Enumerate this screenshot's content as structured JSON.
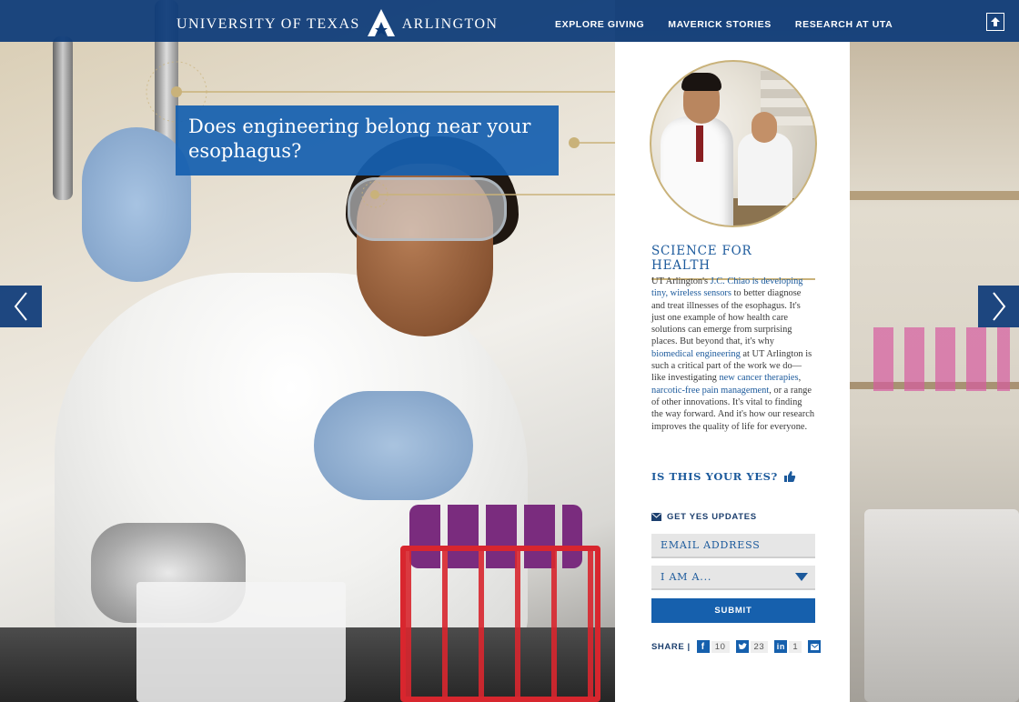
{
  "header": {
    "brand_left": "UNIVERSITY OF TEXAS",
    "brand_right": "ARLINGTON",
    "nav": [
      "EXPLORE GIVING",
      "MAVERICK STORIES",
      "RESEARCH AT UTA"
    ],
    "top_icon": "arrow-up-icon"
  },
  "headline": "Does engineering belong near your esophagus?",
  "panel": {
    "title": "SCIENCE FOR HEALTH",
    "body": {
      "t1": "UT Arlington's ",
      "l1": "J.C. Chiao is developing tiny, wireless sensors",
      "t2": " to better diagnose and treat illnesses of the esophagus. It's just one example of how health care solutions can emerge from surprising places. But beyond that, it's why ",
      "l2": "biomedical engineering",
      "t3": " at UT Arlington is such a critical part of the work we do—like investigating ",
      "l3": "new cancer therapies",
      "t4": ", ",
      "l4": "narcotic-free pain management",
      "t5": ", or a range of other innovations. It's vital to finding the way forward. And it's how our research improves the quality of life for everyone."
    },
    "cta": "IS THIS YOUR YES?",
    "updates_label": "GET YES UPDATES",
    "email_placeholder": "EMAIL ADDRESS",
    "select_value": "I AM A...",
    "submit_label": "SUBMIT",
    "share_label": "SHARE |",
    "share": {
      "facebook": "10",
      "twitter": "23",
      "linkedin": "1"
    }
  },
  "colors": {
    "brand_blue": "#0c3a78",
    "accent_blue": "#1660ad",
    "gold": "#c9b27a"
  }
}
